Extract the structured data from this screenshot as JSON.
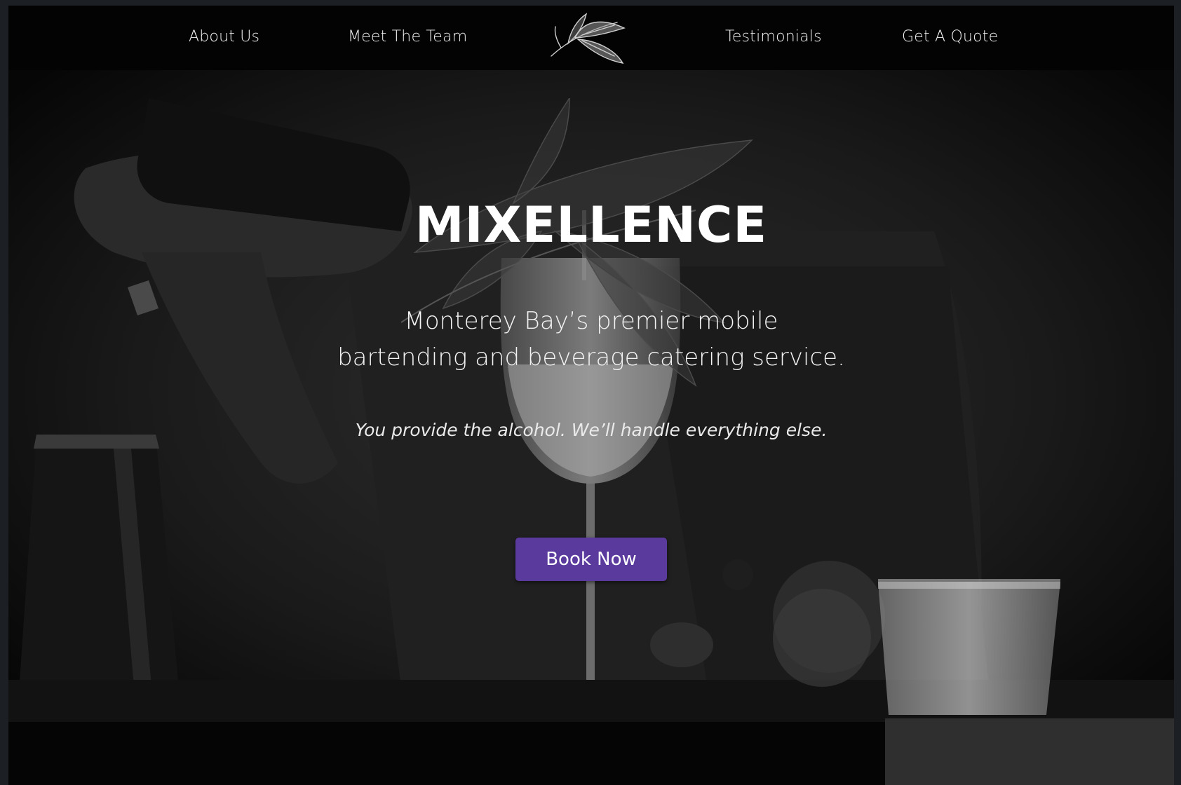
{
  "nav": {
    "items": [
      {
        "label": "About Us"
      },
      {
        "label": "Meet The Team"
      },
      {
        "label": "Testimonials"
      },
      {
        "label": "Get A Quote"
      }
    ],
    "logo_icon": "feather-logo-icon"
  },
  "hero": {
    "title": "MIXELLENCE",
    "subtitle_line1": "Monterey Bay’s premier mobile",
    "subtitle_line2": "bartending and beverage catering service.",
    "tagline": "You provide the alcohol. We’ll handle everything else.",
    "cta_label": "Book Now",
    "background_image": "bartender-pouring-wine-photo",
    "watermark_icon": "feather-watermark-icon"
  },
  "colors": {
    "accent": "#5b3a9e",
    "background": "#000000",
    "text": "#ffffff"
  }
}
